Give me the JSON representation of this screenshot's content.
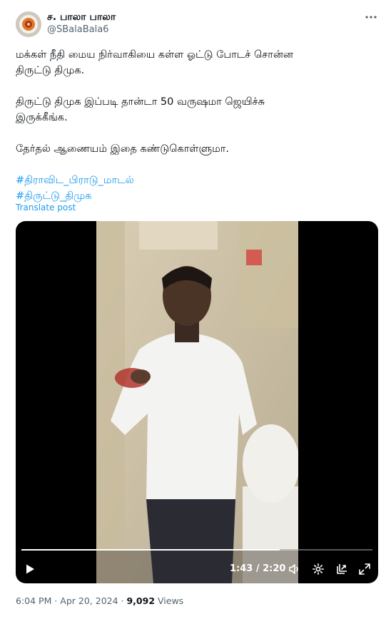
{
  "author": {
    "display_name": "ச. பாலா பாலா",
    "handle": "@SBalaBala6"
  },
  "post": {
    "lines": [
      "மக்கள் நீதி மைய நிர்வாகியை கள்ள ஓட்டு போடச் சொன்ன",
      "திருட்டு திமுக.",
      "திருட்டு திமுக இப்படி தான்டா 50 வருஷமா ஜெயிச்சு",
      "இருக்கீங்க.",
      "தேர்தல் ஆணையம் இதை கண்டுகொள்ளுமா."
    ],
    "hashtags": [
      "#திராவிட_பிராடு_மாடல்",
      "#திருட்டு_திமுக"
    ],
    "translate_label": "Translate post"
  },
  "video": {
    "time_display": "1:43 / 2:20",
    "progress_fraction": 0.736
  },
  "meta": {
    "time": "6:04 PM",
    "separator_1": " · ",
    "date": "Apr 20, 2024",
    "separator_2": " · ",
    "views_count": "9,092",
    "views_label": " Views"
  },
  "colors": {
    "link": "#1d9bf0",
    "text": "#0f1419",
    "muted": "#536471"
  },
  "icons": {
    "more": "more-horizontal-icon",
    "play": "play-icon",
    "volume": "volume-icon",
    "settings": "settings-gear-icon",
    "pip": "picture-in-picture-icon",
    "fullscreen": "fullscreen-icon"
  }
}
